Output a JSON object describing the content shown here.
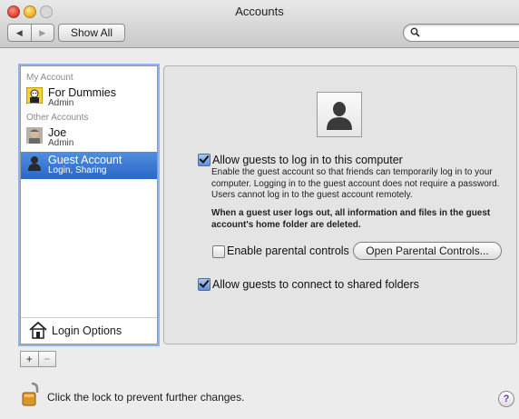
{
  "window": {
    "title": "Accounts"
  },
  "toolbar": {
    "back_glyph": "◀",
    "forward_glyph": "▶",
    "show_all_label": "Show All",
    "search_placeholder": ""
  },
  "sidebar": {
    "my_account_header": "My Account",
    "other_accounts_header": "Other Accounts",
    "accounts": [
      {
        "name": "For Dummies",
        "role": "Admin",
        "icon": "dummies-avatar-icon",
        "selected": false
      },
      {
        "name": "Joe",
        "role": "Admin",
        "icon": "joe-avatar-icon",
        "selected": false
      },
      {
        "name": "Guest Account",
        "role": "Login, Sharing",
        "icon": "guest-silhouette-icon",
        "selected": true
      }
    ],
    "login_options_label": "Login Options",
    "add_glyph": "+",
    "remove_glyph": "−"
  },
  "guest": {
    "allow_login_label": "Allow guests to log in to this computer",
    "allow_login_checked": true,
    "description": "Enable the guest account so that friends can temporarily log in to your computer. Logging in to the guest account does not require a password. Users cannot log in to the guest account remotely.",
    "warning": "When a guest user logs out, all information and files in the guest account's home folder are deleted.",
    "parental_label": "Enable parental controls",
    "parental_checked": false,
    "open_parental_label": "Open Parental Controls...",
    "shared_folders_label": "Allow guests to connect to shared folders",
    "shared_folders_checked": true
  },
  "footer": {
    "lock_text": "Click the lock to prevent further changes.",
    "help_glyph": "?"
  },
  "colors": {
    "selection": "#2a67c8",
    "focus_ring": "#8fb4ea",
    "window_bg": "#ececec"
  }
}
